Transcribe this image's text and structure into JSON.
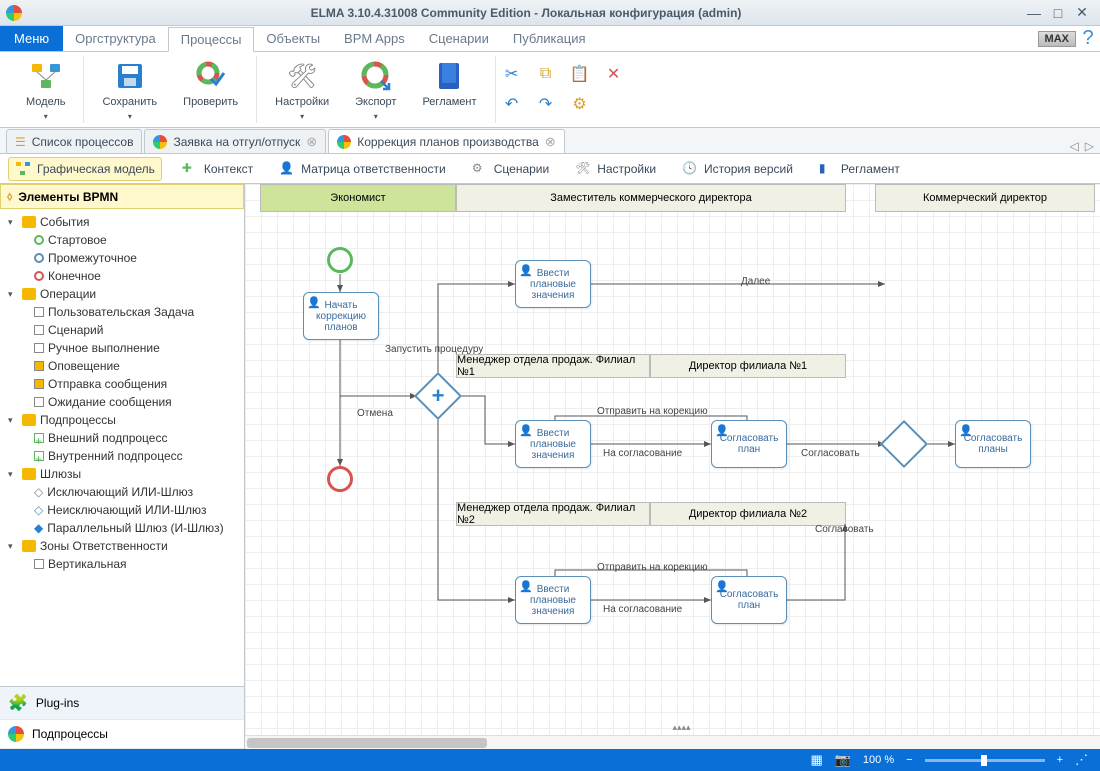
{
  "window": {
    "title": "ELMA 3.10.4.31008 Community Edition - Локальная конфигурация (admin)"
  },
  "menu": {
    "button": "Меню",
    "items": [
      "Оргструктура",
      "Процессы",
      "Объекты",
      "BPM Apps",
      "Сценарии",
      "Публикация"
    ],
    "active_index": 1,
    "max_badge": "MAX"
  },
  "toolbar": {
    "model": "Модель",
    "save": "Сохранить",
    "check": "Проверить",
    "settings": "Настройки",
    "export": "Экспорт",
    "reglament": "Регламент"
  },
  "doctabs": {
    "tabs": [
      {
        "label": "Список процессов",
        "icon": "list"
      },
      {
        "label": "Заявка на отгул/отпуск",
        "icon": "ring"
      },
      {
        "label": "Коррекция планов производства",
        "icon": "ring"
      }
    ],
    "active_index": 2
  },
  "viewtabs": [
    {
      "label": "Графическая модель",
      "active": true
    },
    {
      "label": "Контекст"
    },
    {
      "label": "Матрица ответственности"
    },
    {
      "label": "Сценарии"
    },
    {
      "label": "Настройки"
    },
    {
      "label": "История версий"
    },
    {
      "label": "Регламент"
    }
  ],
  "sidebar": {
    "header": "Элементы BPMN",
    "groups": [
      {
        "label": "События",
        "items": [
          {
            "label": "Стартовое",
            "color": "#5cb85c"
          },
          {
            "label": "Промежуточное",
            "color": "#5a8fb8"
          },
          {
            "label": "Конечное",
            "color": "#d9534f"
          }
        ]
      },
      {
        "label": "Операции",
        "items": [
          {
            "label": "Пользовательская Задача"
          },
          {
            "label": "Сценарий"
          },
          {
            "label": "Ручное выполнение"
          },
          {
            "label": "Оповещение"
          },
          {
            "label": "Отправка сообщения"
          },
          {
            "label": "Ожидание сообщения"
          }
        ]
      },
      {
        "label": "Подпроцессы",
        "items": [
          {
            "label": "Внешний подпроцесс"
          },
          {
            "label": "Внутренний подпроцесс"
          }
        ]
      },
      {
        "label": "Шлюзы",
        "items": [
          {
            "label": "Исключающий ИЛИ-Шлюз"
          },
          {
            "label": "Неисключающий ИЛИ-Шлюз"
          },
          {
            "label": "Параллельный Шлюз (И-Шлюз)"
          }
        ]
      },
      {
        "label": "Зоны Ответственности",
        "items": [
          {
            "label": "Вертикальная"
          }
        ]
      }
    ],
    "bottom": [
      {
        "label": "Plug-ins"
      },
      {
        "label": "Подпроцессы"
      }
    ]
  },
  "lanes": {
    "economist": "Экономист",
    "deputy": "Заместитель коммерческого директора",
    "commercial": "Коммерческий директор",
    "mgr1": "Менеджер отдела продаж. Филиал №1",
    "dir1": "Директор филиала №1",
    "mgr2": "Менеджер отдела продаж. Филиал №2",
    "dir2": "Директор филиала №2"
  },
  "tasks": {
    "start_correction": "Начать коррекцию планов",
    "enter_plan": "Ввести плановые значения",
    "agree_plan": "Согласовать план",
    "agree_plans": "Согласовать планы"
  },
  "labels": {
    "cancel": "Отмена",
    "launch": "Запустить процедуру",
    "next": "Далее",
    "send_correction": "Отправить на корекцию",
    "to_agreement": "На согласование",
    "agree": "Согласовать"
  },
  "status": {
    "zoom": "100 %"
  }
}
